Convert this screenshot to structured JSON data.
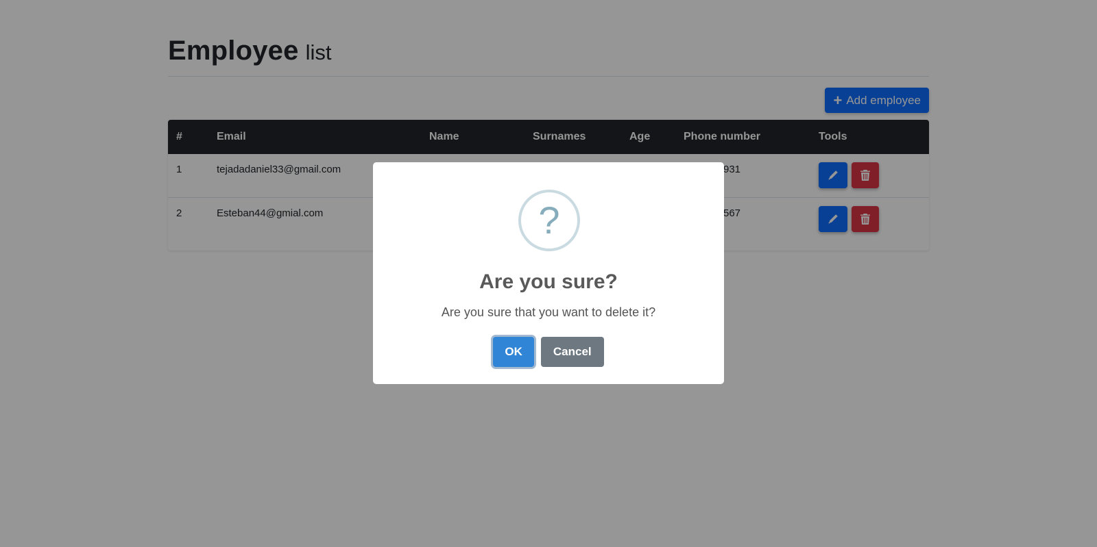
{
  "header": {
    "title_main": "Employee",
    "title_sub": "list"
  },
  "toolbar": {
    "add_label": "Add employee",
    "add_icon": "plus-icon"
  },
  "table": {
    "columns": [
      "#",
      "Email",
      "Name",
      "Surnames",
      "Age",
      "Phone number",
      "Tools"
    ],
    "rows": [
      {
        "id": "1",
        "email": "tejadadaniel33@gmail.com",
        "name": "",
        "surnames": "",
        "age": "",
        "phone": "931"
      },
      {
        "id": "2",
        "email": "Esteban44@gmial.com",
        "name": "",
        "surnames": "",
        "age": "",
        "phone": "567"
      }
    ]
  },
  "modal": {
    "icon": "?",
    "title": "Are you sure?",
    "text": "Are you sure that you want to delete it?",
    "ok_label": "OK",
    "cancel_label": "Cancel"
  },
  "colors": {
    "primary": "#0d6efd",
    "danger": "#dc3545",
    "header_dark": "#212529",
    "confirm": "#3085d6",
    "cancel": "#6e7881"
  }
}
